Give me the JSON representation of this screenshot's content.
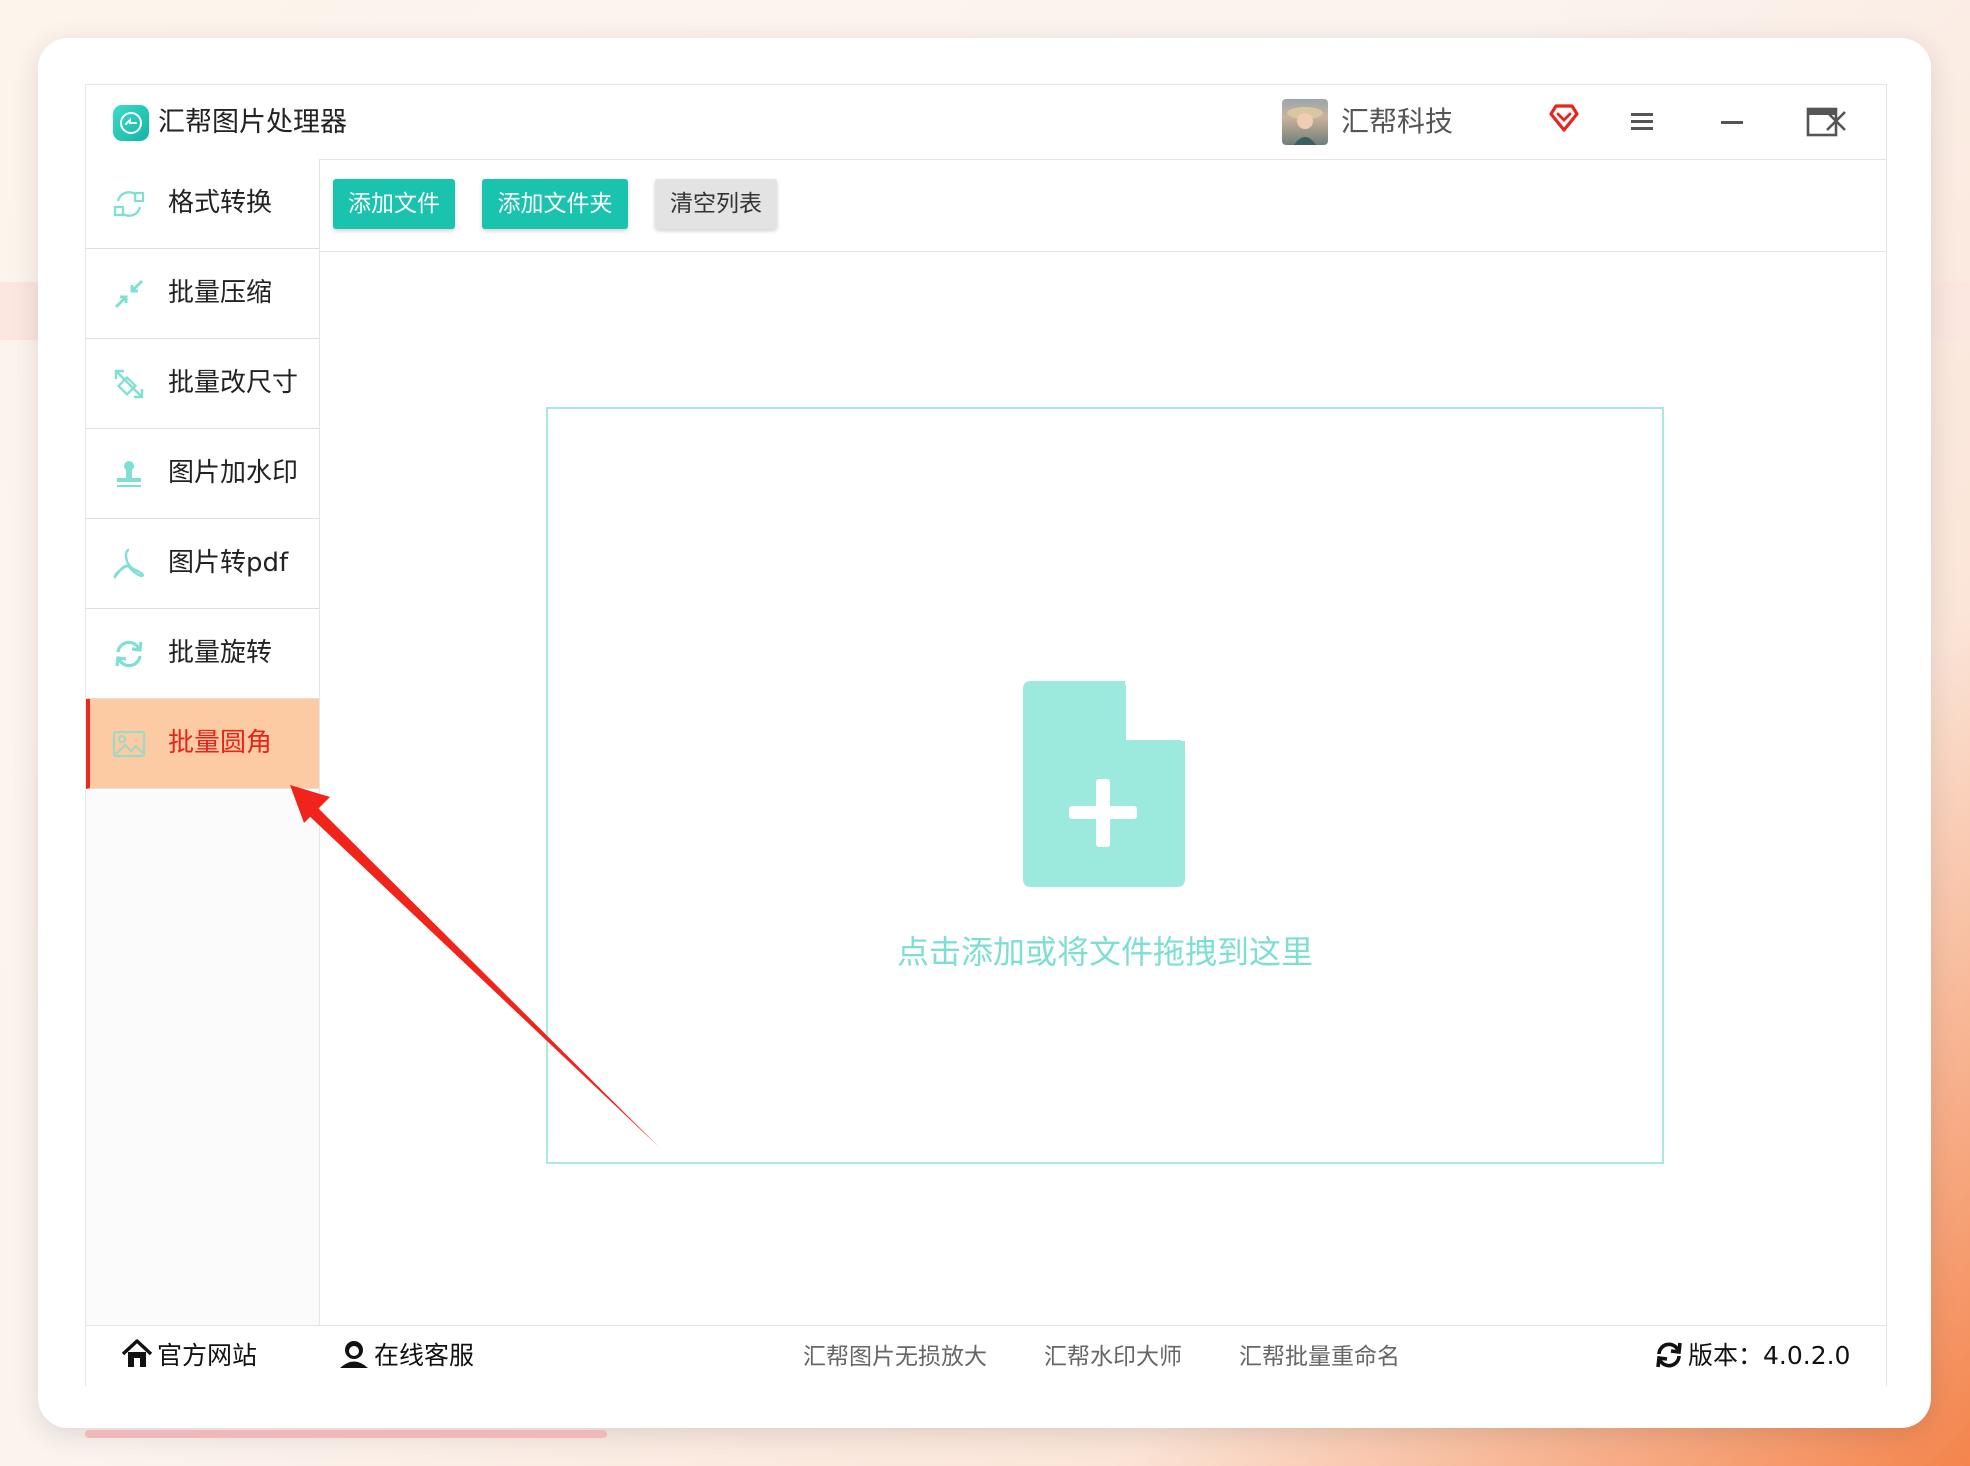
{
  "app": {
    "title": "汇帮图片处理器"
  },
  "user": {
    "name": "汇帮科技"
  },
  "colors": {
    "accent": "#19c3ad",
    "active_bg": "#fccba4",
    "active_text": "#e8231a",
    "drop_border": "#a8e9e0"
  },
  "sidebar": {
    "items": [
      {
        "label": "格式转换",
        "icon": "format-convert-icon"
      },
      {
        "label": "批量压缩",
        "icon": "compress-icon"
      },
      {
        "label": "批量改尺寸",
        "icon": "resize-icon"
      },
      {
        "label": "图片加水印",
        "icon": "watermark-icon"
      },
      {
        "label": "图片转pdf",
        "icon": "pdf-icon"
      },
      {
        "label": "批量旋转",
        "icon": "rotate-icon"
      },
      {
        "label": "批量圆角",
        "icon": "round-corner-icon",
        "active": true
      }
    ]
  },
  "toolbar": {
    "add_file": "添加文件",
    "add_folder": "添加文件夹",
    "clear_list": "清空列表"
  },
  "dropzone": {
    "hint": "点击添加或将文件拖拽到这里"
  },
  "footer": {
    "website": "官方网站",
    "support": "在线客服",
    "apps": [
      "汇帮图片无损放大",
      "汇帮水印大师",
      "汇帮批量重命名"
    ],
    "version": "版本：4.0.2.0"
  }
}
